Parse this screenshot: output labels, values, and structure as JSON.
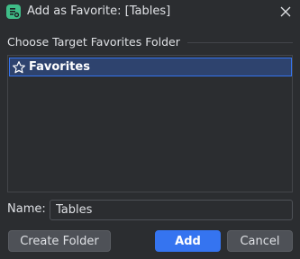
{
  "window": {
    "title": "Add as Favorite: [Tables]",
    "app_icon": "database-tool-icon",
    "close_icon": "close-icon"
  },
  "folders": {
    "group_label": "Choose Target Favorites Folder",
    "items": [
      {
        "label": "Favorites",
        "icon": "star-icon",
        "selected": true
      }
    ]
  },
  "name_field": {
    "label": "Name:",
    "value": "Tables"
  },
  "buttons": {
    "create_folder": "Create Folder",
    "add": "Add",
    "cancel": "Cancel"
  },
  "colors": {
    "background": "#2b2d30",
    "accent": "#3574f0",
    "selection": "#2e436e",
    "app_icon": "#3fbd88"
  }
}
